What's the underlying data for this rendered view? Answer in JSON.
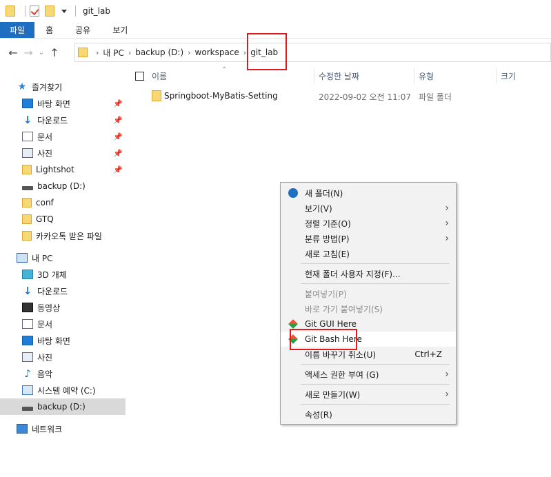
{
  "window": {
    "title": "git_lab"
  },
  "ribbon": {
    "tabs": [
      "파일",
      "홈",
      "공유",
      "보기"
    ]
  },
  "nav": {
    "back_icon": "left-arrow-icon",
    "forward_icon": "right-arrow-icon",
    "recent_icon": "chevron-down-icon",
    "up_icon": "up-arrow-icon"
  },
  "breadcrumb": {
    "items": [
      "내 PC",
      "backup (D:)",
      "workspace",
      "git_lab"
    ]
  },
  "columns": {
    "name": "이름",
    "modified": "수정한 날짜",
    "type": "유형",
    "size": "크기"
  },
  "files": [
    {
      "name": "Springboot-MyBatis-Setting",
      "modified": "2022-09-02 오전 11:07",
      "type": "파일 폴더"
    }
  ],
  "sidebar": {
    "quick_access": "즐겨찾기",
    "quick_items": [
      {
        "label": "바탕 화면",
        "icon": "desktop-icon",
        "pinned": true
      },
      {
        "label": "다운로드",
        "icon": "download-icon",
        "pinned": true
      },
      {
        "label": "문서",
        "icon": "document-icon",
        "pinned": true
      },
      {
        "label": "사진",
        "icon": "pictures-icon",
        "pinned": true
      },
      {
        "label": "Lightshot",
        "icon": "folder-icon",
        "pinned": true
      },
      {
        "label": "backup (D:)",
        "icon": "drive-icon",
        "pinned": false
      },
      {
        "label": "conf",
        "icon": "folder-icon",
        "pinned": false
      },
      {
        "label": "GTQ",
        "icon": "folder-icon",
        "pinned": false
      },
      {
        "label": "카카오톡 받은 파일",
        "icon": "folder-icon",
        "pinned": false
      }
    ],
    "this_pc": "내 PC",
    "pc_items": [
      {
        "label": "3D 개체",
        "icon": "3d-objects-icon"
      },
      {
        "label": "다운로드",
        "icon": "download-icon"
      },
      {
        "label": "동영상",
        "icon": "video-icon"
      },
      {
        "label": "문서",
        "icon": "document-icon"
      },
      {
        "label": "바탕 화면",
        "icon": "desktop-icon"
      },
      {
        "label": "사진",
        "icon": "pictures-icon"
      },
      {
        "label": "음악",
        "icon": "music-icon"
      },
      {
        "label": "시스템 예약 (C:)",
        "icon": "system-drive-icon"
      },
      {
        "label": "backup (D:)",
        "icon": "drive-icon",
        "selected": true
      }
    ],
    "network": "네트워크"
  },
  "context_menu": {
    "items": [
      {
        "label": "새 폴더(N)",
        "icon": "new-folder-icon"
      },
      {
        "label": "보기(V)",
        "submenu": true
      },
      {
        "label": "정렬 기준(O)",
        "submenu": true
      },
      {
        "label": "분류 방법(P)",
        "submenu": true
      },
      {
        "label": "새로 고침(E)"
      },
      {
        "label": "현재 폴더 사용자 지정(F)..."
      },
      {
        "label": "붙여넣기(P)",
        "disabled": true
      },
      {
        "label": "바로 가기 붙여넣기(S)",
        "disabled": true
      },
      {
        "label": "Git GUI Here",
        "icon": "git-icon"
      },
      {
        "label": "Git Bash Here",
        "icon": "git-icon",
        "highlighted": true
      },
      {
        "label": "이름 바꾸기 취소(U)",
        "shortcut": "Ctrl+Z"
      },
      {
        "label": "액세스 권한 부여 (G)",
        "submenu": true
      },
      {
        "label": "새로 만들기(W)",
        "submenu": true
      },
      {
        "label": "속성(R)"
      }
    ]
  },
  "colors": {
    "accent": "#1e6fc1",
    "highlight_box": "#e0191e",
    "menu_bg": "#f2f2f2"
  }
}
